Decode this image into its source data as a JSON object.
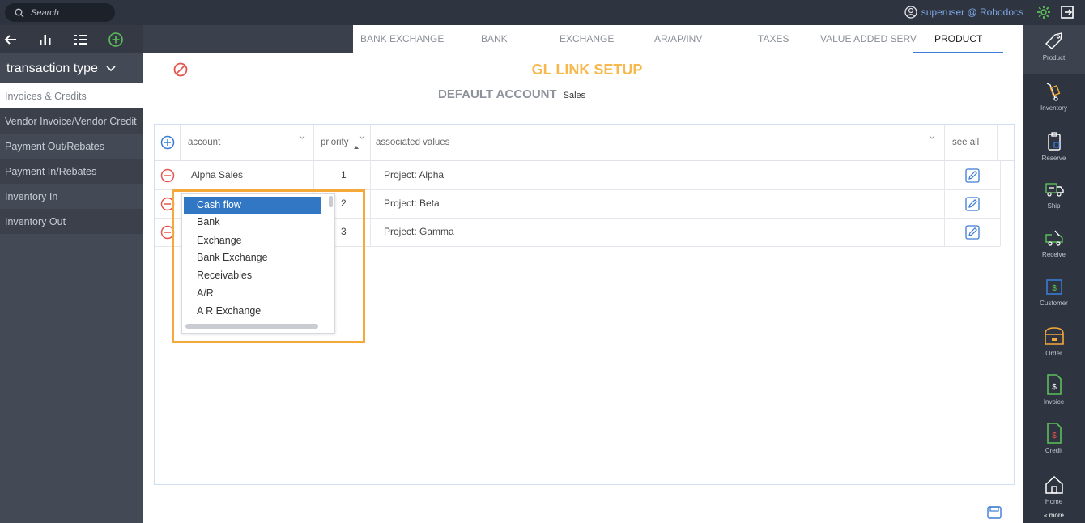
{
  "topbar": {
    "search_placeholder": "Search",
    "user": "superuser @ Robodocs"
  },
  "sidebar": {
    "type_label": "transaction type",
    "items": [
      {
        "label": "Invoices & Credits"
      },
      {
        "label": "Vendor Invoice/Vendor Credit"
      },
      {
        "label": "Payment Out/Rebates"
      },
      {
        "label": "Payment In/Rebates"
      },
      {
        "label": "Inventory In"
      },
      {
        "label": "Inventory Out"
      }
    ]
  },
  "tabs": [
    {
      "label": "BANK EXCHANGE"
    },
    {
      "label": "BANK"
    },
    {
      "label": "EXCHANGE"
    },
    {
      "label": "AR/AP/INV"
    },
    {
      "label": "TAXES"
    },
    {
      "label": "VALUE ADDED SERV"
    },
    {
      "label": "PRODUCT"
    }
  ],
  "main": {
    "title": "GL LINK SETUP",
    "default_account_label": "DEFAULT ACCOUNT",
    "default_account_value": "Sales"
  },
  "table": {
    "headers": {
      "account": "account",
      "priority": "priority",
      "associated_values": "associated values",
      "see_all": "see all"
    },
    "rows": [
      {
        "account": "Alpha Sales",
        "priority": "1",
        "associated": "Project: Alpha"
      },
      {
        "account": "",
        "priority": "2",
        "associated": "Project: Beta"
      },
      {
        "account": "",
        "priority": "3",
        "associated": "Project: Gamma"
      }
    ]
  },
  "dropdown": {
    "options": [
      "Cash flow",
      "Bank",
      "Exchange",
      "Bank Exchange",
      "Receivables",
      "A/R",
      "A R Exchange"
    ],
    "selected": "Cash flow"
  },
  "rail": {
    "items": [
      {
        "label": "Product",
        "icon": "tag-icon"
      },
      {
        "label": "Inventory",
        "icon": "hand-truck-icon"
      },
      {
        "label": "Reserve",
        "icon": "clipboard-icon"
      },
      {
        "label": "Ship",
        "icon": "ship-truck-icon"
      },
      {
        "label": "Receive",
        "icon": "receive-truck-icon"
      },
      {
        "label": "Customer",
        "icon": "customer-icon"
      },
      {
        "label": "Order",
        "icon": "order-box-icon"
      },
      {
        "label": "Invoice",
        "icon": "invoice-doc-icon"
      },
      {
        "label": "Credit",
        "icon": "credit-doc-icon"
      },
      {
        "label": "Home",
        "icon": "home-icon"
      }
    ],
    "more_label": "« more"
  },
  "colors": {
    "accent_orange": "#f7b84e",
    "highlight_orange": "#f5a93b",
    "remove_red": "#e3564d",
    "add_blue": "#3a7bd5",
    "green": "#5cc15a",
    "selected_blue": "#3277c4"
  }
}
